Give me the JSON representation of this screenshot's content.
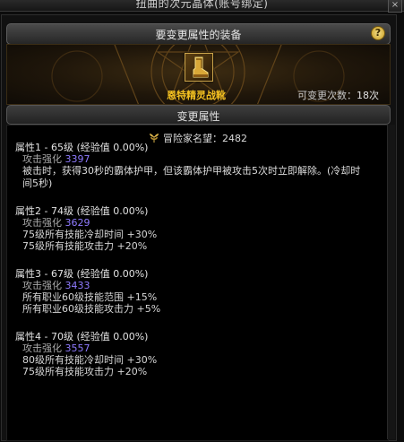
{
  "window": {
    "title": "扭曲的次元晶体(账号绑定)",
    "close_symbol": "×"
  },
  "equipment_header": {
    "label": "要变更属性的装备",
    "help_symbol": "?"
  },
  "item": {
    "name": "恩特精灵战靴",
    "change_count_label": "可变更次数：",
    "change_count_value": "18次",
    "icon": "boots-icon"
  },
  "attributes_header": {
    "label": "变更属性"
  },
  "adventurer_fame": {
    "label": "冒险家名望：",
    "value": "2482",
    "icon": "laurel-icon"
  },
  "attributes": [
    {
      "title": "属性1 - 65级 (经验值 0.00%)",
      "attack_label": "攻击强化",
      "attack_value": "3397",
      "lines": [
        "被击时，获得30秒的霸体护甲，但该霸体护甲被攻击5次时立即解除。(冷却时间5秒)"
      ]
    },
    {
      "title": "属性2 - 74级 (经验值 0.00%)",
      "attack_label": "攻击强化",
      "attack_value": "3629",
      "lines": [
        "75级所有技能冷却时间 +30%",
        "75级所有技能攻击力 +20%"
      ]
    },
    {
      "title": "属性3 - 67级 (经验值 0.00%)",
      "attack_label": "攻击强化",
      "attack_value": "3433",
      "lines": [
        "所有职业60级技能范围 +15%",
        "所有职业60级技能攻击力 +5%"
      ]
    },
    {
      "title": "属性4 - 70级 (经验值 0.00%)",
      "attack_label": "攻击强化",
      "attack_value": "3557",
      "lines": [
        "80级所有技能冷却时间 +30%",
        "75级所有技能攻击力 +20%"
      ]
    }
  ],
  "colors": {
    "item_name": "#f2c020",
    "attack_value": "#8f7bff",
    "panel_gold": "#c9a34a"
  }
}
